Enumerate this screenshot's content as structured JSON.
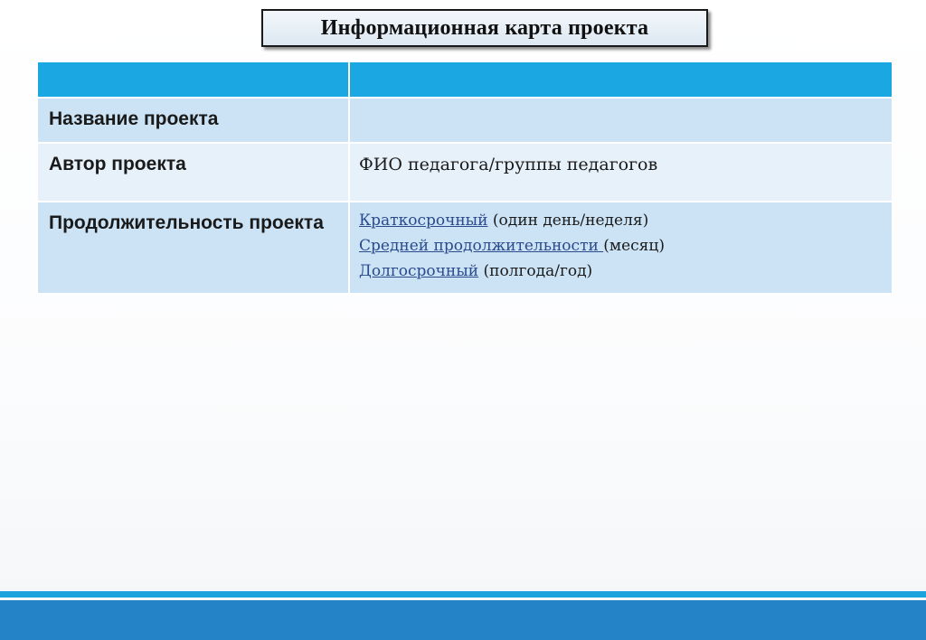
{
  "slide": {
    "title": "Информационная карта проекта"
  },
  "table": {
    "header": [
      "",
      ""
    ],
    "rows": [
      {
        "label": "Название проекта",
        "value": ""
      },
      {
        "label": "Автор проекта",
        "value": "ФИО педагога/группы педагогов"
      },
      {
        "label": "Продолжительность проекта",
        "options": [
          {
            "link": "Краткосрочный",
            "rest": " (один день/неделя)"
          },
          {
            "link": "Средней продолжительности ",
            "rest": "(месяц)"
          },
          {
            "link": "Долгосрочный",
            "rest": " (полгода/год)"
          }
        ]
      }
    ]
  },
  "colors": {
    "header_row": "#1ba8e2",
    "row_dark": "#cbe3f5",
    "row_light": "#e6f1fa",
    "link": "#2b4a8c",
    "bottom_bar": "#2482c6"
  }
}
